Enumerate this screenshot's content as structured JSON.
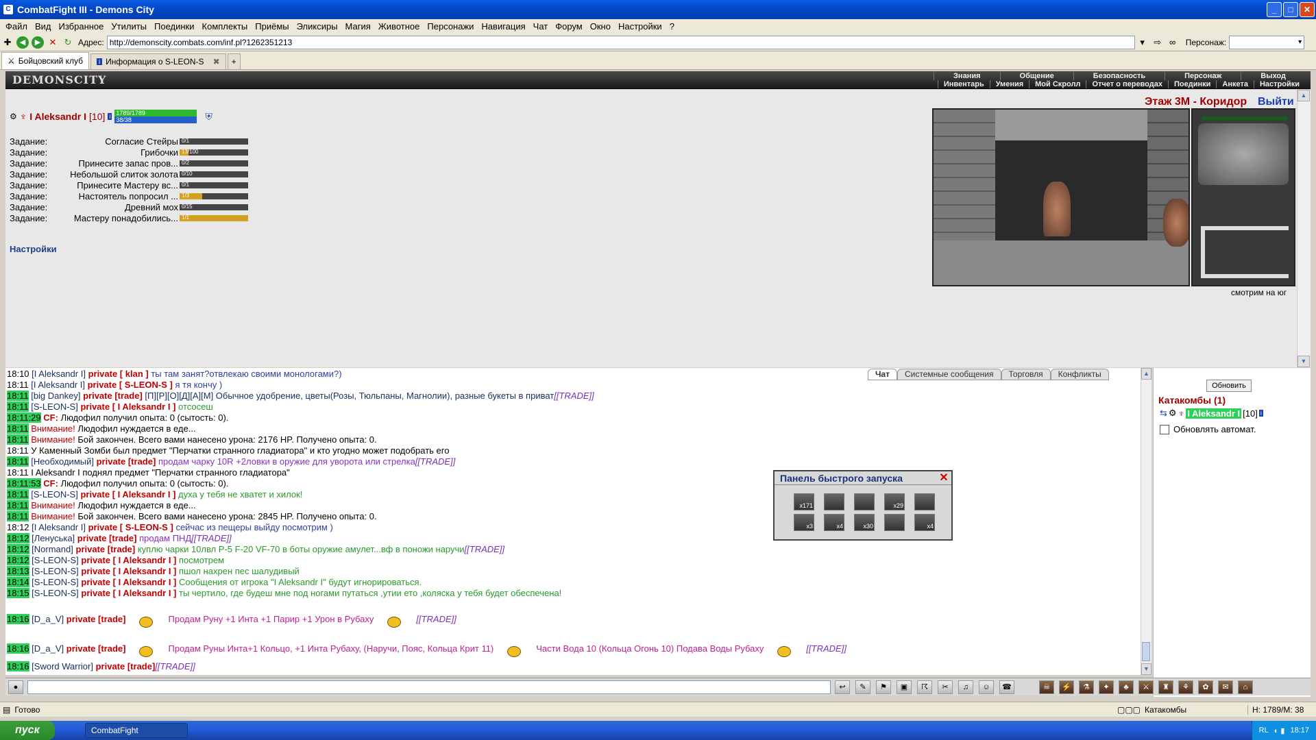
{
  "window": {
    "title": "CombatFight III - Demons City"
  },
  "menu": [
    "Файл",
    "Вид",
    "Избранное",
    "Утилиты",
    "Поединки",
    "Комплекты",
    "Приёмы",
    "Эликсиры",
    "Магия",
    "Животное",
    "Персонажи",
    "Навигация",
    "Чат",
    "Форум",
    "Окно",
    "Настройки",
    "?"
  ],
  "address": {
    "label": "Адрес:",
    "url": "http://demonscity.combats.com/inf.pl?1262351213",
    "persona_label": "Персонаж:"
  },
  "tabs": [
    "Бойцовский клуб",
    "Информация о S-LEON-S"
  ],
  "game": {
    "logo": "DEMONSCITY",
    "nav_top": [
      "Знания",
      "Общение",
      "Безопасность",
      "Персонаж",
      "Выход"
    ],
    "nav_bottom": [
      "Инвентарь",
      "Умения",
      "Мой Скролл",
      "Отчет о переводах",
      "Поединки",
      "Анкета",
      "Настройки"
    ]
  },
  "character": {
    "name": "I Aleksandr I",
    "level": "[10]",
    "hp": "1789/1789",
    "mana": "38/38"
  },
  "tasks": [
    {
      "label": "Задание:",
      "name": "Согласие Стейры",
      "progress": "0/1",
      "fraction": 0.0
    },
    {
      "label": "Задание:",
      "name": "Грибочки",
      "progress": "13/100",
      "fraction": 0.13
    },
    {
      "label": "Задание:",
      "name": "Принесите запас пров...",
      "progress": "0/2",
      "fraction": 0.0
    },
    {
      "label": "Задание:",
      "name": "Небольшой слиток золота",
      "progress": "0/10",
      "fraction": 0.0
    },
    {
      "label": "Задание:",
      "name": "Принесите Мастеру вс...",
      "progress": "0/1",
      "fraction": 0.0
    },
    {
      "label": "Задание:",
      "name": "Настоятель попросил ...",
      "progress": "1/3",
      "fraction": 0.33
    },
    {
      "label": "Задание:",
      "name": "Древний мох",
      "progress": "0/15",
      "fraction": 0.0
    },
    {
      "label": "Задание:",
      "name": "Мастеру понадобились...",
      "progress": "1/1",
      "fraction": 1.0
    }
  ],
  "settings_link": "Настройки",
  "location": {
    "title": "Этаж 3М - Коридор",
    "exit": "Выйти",
    "facing": "смотрим на юг"
  },
  "chat_tabs": [
    "Чат",
    "Системные сообщения",
    "Торговля",
    "Конфликты"
  ],
  "chat": [
    {
      "t": "18:10",
      "hl": false,
      "nick": "[I Aleksandr I]",
      "priv": "private [ klan ]",
      "msg": "ты там занят?отвлекаю своими монологами?)",
      "cls": "msg"
    },
    {
      "t": "18:11",
      "hl": false,
      "nick": "[I Aleksandr I]",
      "priv": "private [ S-LEON-S ]",
      "msg": "я тя кончу )",
      "cls": "msg"
    },
    {
      "t": "18:11",
      "hl": true,
      "nick": "[big Dankey]",
      "priv": "private [trade]",
      "msg": "[П][Р][О][Д][А][М] Обычное удобрение, цветы(Розы, Тюльпаны, Магнолии), разные букеты в приват",
      "trade": "[[TRADE]]",
      "cls": "msgb"
    },
    {
      "t": "18:11",
      "hl": true,
      "nick": "[S-LEON-S]",
      "priv": "private [ I Aleksandr I ]",
      "msg": "отсосеш",
      "cls": "green"
    },
    {
      "t": "18:11:29",
      "hl": true,
      "nick": "",
      "priv": "CF:",
      "msg": "Людофил получил опыта: 0 (сытость: 0).",
      "cls": "plain"
    },
    {
      "t": "18:11",
      "hl": true,
      "nick": "",
      "priv": "Внимание!",
      "msg": "Людофил нуждается в еде...",
      "cls": "plain",
      "privcls": "sys"
    },
    {
      "t": "18:11",
      "hl": true,
      "nick": "",
      "priv": "Внимание!",
      "msg": "Бой закончен. Всего вами нанесено урона: 2176 HP. Получено опыта: 0.",
      "cls": "plain",
      "privcls": "sys"
    },
    {
      "t": "18:11",
      "hl": false,
      "nick": "",
      "priv": "",
      "msg": "У Каменный Зомби был предмет \"Перчатки странного гладиатора\" и кто угодно может подобрать его",
      "cls": "plain"
    },
    {
      "t": "18:11",
      "hl": true,
      "nick": "[Необходимый]",
      "priv": "private [trade]",
      "msg": "продам чарку 10R +2ловки в оружие для уворота или стрелка",
      "trade": "[[TRADE]]",
      "cls": "purple"
    },
    {
      "t": "18:11",
      "hl": false,
      "nick": "",
      "priv": "",
      "msg": "I Aleksandr I поднял предмет \"Перчатки странного гладиатора\"",
      "cls": "plain"
    },
    {
      "t": "18:11:53",
      "hl": true,
      "nick": "",
      "priv": "CF:",
      "msg": "Людофил получил опыта: 0 (сытость: 0).",
      "cls": "plain"
    },
    {
      "t": "18:11",
      "hl": true,
      "nick": "[S-LEON-S]",
      "priv": "private [ I Aleksandr I ]",
      "msg": "духа у тебя не хватет и хилок!",
      "cls": "green"
    },
    {
      "t": "18:11",
      "hl": true,
      "nick": "",
      "priv": "Внимание!",
      "msg": "Людофил нуждается в еде...",
      "cls": "plain",
      "privcls": "sys"
    },
    {
      "t": "18:11",
      "hl": true,
      "nick": "",
      "priv": "Внимание!",
      "msg": "Бой закончен. Всего вами нанесено урона: 2845 HP. Получено опыта: 0.",
      "cls": "plain",
      "privcls": "sys"
    },
    {
      "t": "18:12",
      "hl": false,
      "nick": "[I Aleksandr I]",
      "priv": "private [ S-LEON-S ]",
      "msg": "сейчас из пещеры выйду посмотрим )",
      "cls": "msg"
    },
    {
      "t": "18:12",
      "hl": true,
      "nick": "[Ленуська]",
      "priv": "private [trade]",
      "msg": "продам ПНД",
      "trade": "[[TRADE]]",
      "cls": "purple"
    },
    {
      "t": "18:12",
      "hl": true,
      "nick": "[Normand]",
      "priv": "private [trade]",
      "msg": "куплю чарки 10лвл P-5 F-20 VF-70 в боты оружие амулет...вф в поножи наручи",
      "trade": "[[TRADE]]",
      "cls": "green"
    },
    {
      "t": "18:12",
      "hl": true,
      "nick": "[S-LEON-S]",
      "priv": "private [ I Aleksandr I ]",
      "msg": "посмотрем",
      "cls": "green"
    },
    {
      "t": "18:13",
      "hl": true,
      "nick": "[S-LEON-S]",
      "priv": "private [ I Aleksandr I ]",
      "msg": "пшол нахрен пес шалудивый",
      "cls": "green"
    },
    {
      "t": "18:14",
      "hl": true,
      "nick": "[S-LEON-S]",
      "priv": "private [ I Aleksandr I ]",
      "msg": "Сообщения от игрока \"I Aleksandr I\" будут игнорироваться.",
      "cls": "green"
    },
    {
      "t": "18:15",
      "hl": true,
      "nick": "[S-LEON-S]",
      "priv": "private [ I Aleksandr I ]",
      "msg": "ты чертило, где будеш мне под ногами путаться ,утии ето ,коляска у тебя будет обеспечена!",
      "cls": "green"
    }
  ],
  "chat_big": [
    {
      "t": "18:16",
      "nick": "[D_a_V]",
      "priv": "private [trade]",
      "msg1": "Продам Руну +1 Инта +1 Парир +1 Урон в Рубаху",
      "msg2": "",
      "trade": "[[TRADE]]"
    },
    {
      "t": "18:16",
      "nick": "[D_a_V]",
      "priv": "private [trade]",
      "msg1": "Продам Руны Инта+1 Кольцо, +1 Инта Рубаху, (Наручи, Пояс, Кольца Крит 11)",
      "msg2": "Части Вода 10 (Кольца Огонь 10) Подава Воды Рубаху",
      "trade": "[[TRADE]]"
    }
  ],
  "chat_last": {
    "t": "18:16",
    "nick": "[Sword Warrior]",
    "priv": "private [trade]",
    "trade": "[[TRADE]]"
  },
  "right": {
    "refresh": "Обновить",
    "room": "Катакомбы (1)",
    "user": "I Aleksandr I",
    "user_level": "[10]",
    "auto": "Обновлять автомат."
  },
  "quickpanel": {
    "title": "Панель быстрого запуска",
    "slots_row1": [
      "x171",
      "",
      "",
      "x29",
      ""
    ],
    "slots_row2": [
      "x3",
      "x4",
      "x30",
      "",
      "x4"
    ]
  },
  "statusbar": {
    "ready": "Готово",
    "zone": "Катакомбы",
    "hm": "H: 1789/M: 38"
  },
  "taskbar": {
    "start": "пуск",
    "item": "CombatFight",
    "lang": "RL",
    "clock": "18:17"
  }
}
